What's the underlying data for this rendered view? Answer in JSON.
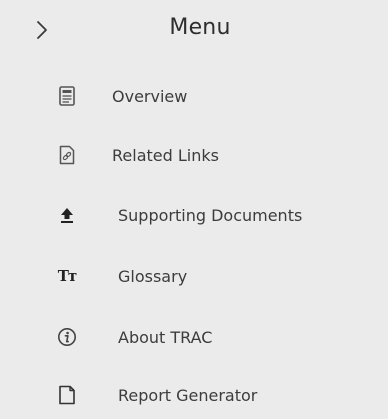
{
  "menu": {
    "title": "Menu",
    "toggle_glyph": ">",
    "items": [
      {
        "label": "Overview",
        "icon": "document-page-icon"
      },
      {
        "label": "Related Links",
        "icon": "link-document-icon"
      },
      {
        "label": "Supporting Documents",
        "icon": "upload-icon"
      },
      {
        "label": "Glossary",
        "icon": "text-size-icon"
      },
      {
        "label": "About TRAC",
        "icon": "info-icon"
      },
      {
        "label": "Report Generator",
        "icon": "report-document-icon"
      }
    ]
  },
  "glyphs": {
    "text_size": "Tт"
  }
}
